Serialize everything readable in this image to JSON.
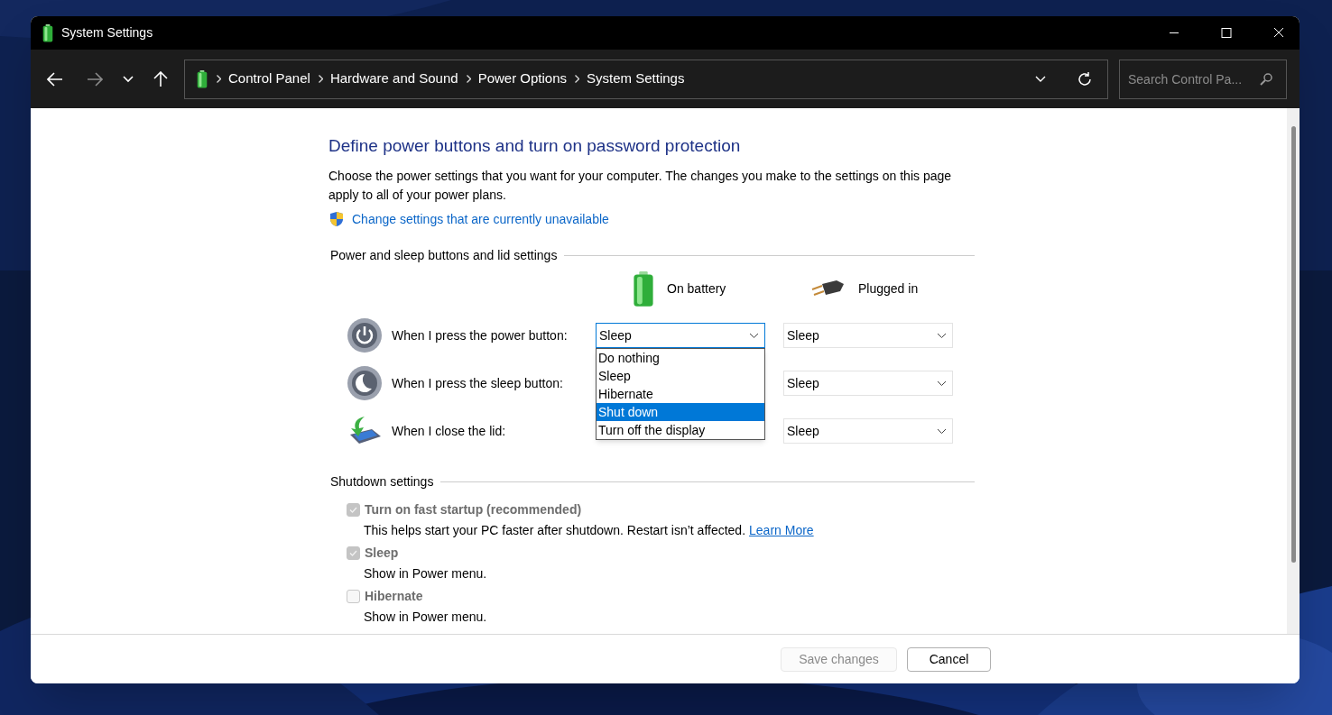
{
  "window": {
    "title": "System Settings"
  },
  "address_bar": {
    "breadcrumbs": [
      "Control Panel",
      "Hardware and Sound",
      "Power Options",
      "System Settings"
    ]
  },
  "search": {
    "placeholder": "Search Control Pa..."
  },
  "heading": "Define power buttons and turn on password protection",
  "description": "Choose the power settings that you want for your computer. The changes you make to the settings on this page apply to all of your power plans.",
  "admin_link": "Change settings that are currently unavailable",
  "power_section": {
    "title": "Power and sleep buttons and lid settings",
    "columns": [
      {
        "kind": "battery",
        "label": "On battery"
      },
      {
        "kind": "plug",
        "label": "Plugged in"
      }
    ],
    "rows": [
      {
        "kind": "power",
        "label": "When I press the power button:",
        "on_battery": "Sleep",
        "plugged_in": "Sleep"
      },
      {
        "kind": "sleep",
        "label": "When I press the sleep button:",
        "plugged_in": "Sleep"
      },
      {
        "kind": "lid",
        "label": "When I close the lid:",
        "plugged_in": "Sleep"
      }
    ],
    "open_dropdown": {
      "options": [
        {
          "label": "Do nothing",
          "selected": false
        },
        {
          "label": "Sleep",
          "selected": false
        },
        {
          "label": "Hibernate",
          "selected": false
        },
        {
          "label": "Shut down",
          "selected": true
        },
        {
          "label": "Turn off the display",
          "selected": false
        }
      ]
    }
  },
  "shutdown_section": {
    "title": "Shutdown settings",
    "items": [
      {
        "label": "Turn on fast startup (recommended)",
        "checked": true,
        "disabled": true,
        "description": "This helps start your PC faster after shutdown. Restart isn’t affected.",
        "link": "Learn More"
      },
      {
        "label": "Sleep",
        "checked": true,
        "disabled": true,
        "description": "Show in Power menu."
      },
      {
        "label": "Hibernate",
        "checked": false,
        "disabled": true,
        "description": "Show in Power menu."
      }
    ]
  },
  "buttons": [
    {
      "label": "Save changes",
      "disabled": true
    },
    {
      "label": "Cancel",
      "disabled": false
    }
  ]
}
